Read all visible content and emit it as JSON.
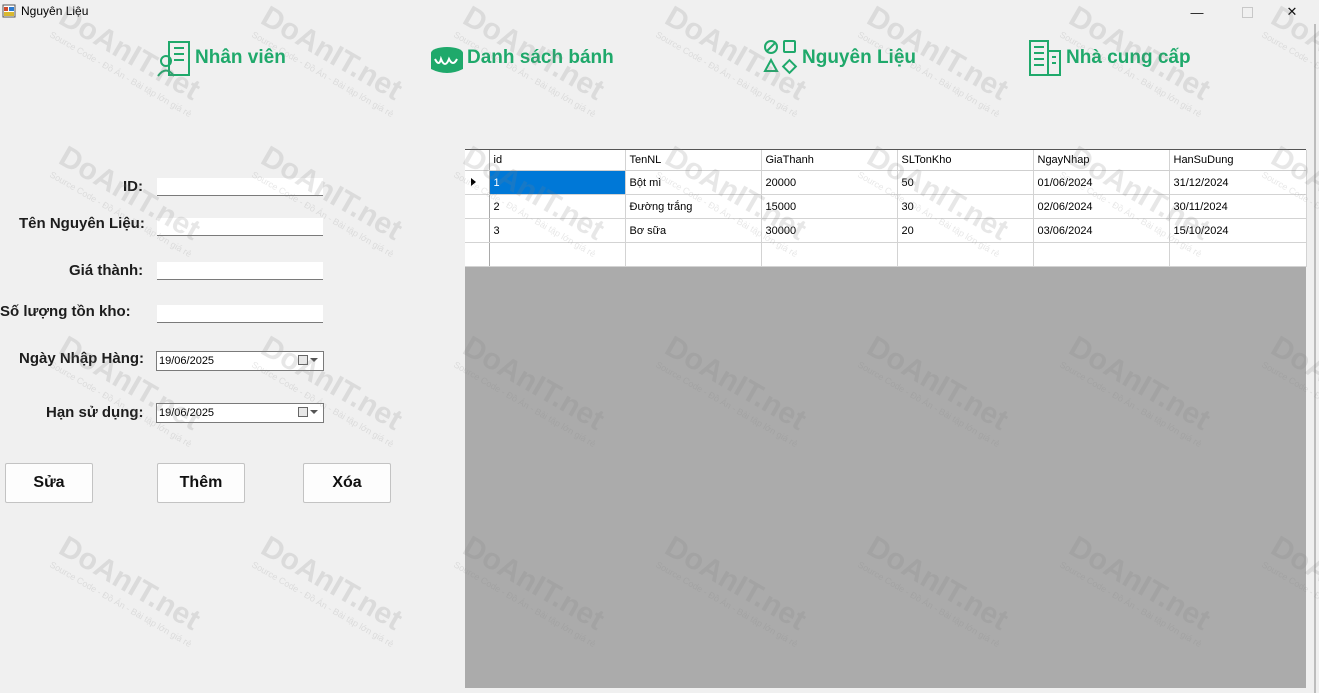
{
  "window": {
    "title": "Nguyên Liệu",
    "minimize_glyph": "—",
    "close_glyph": "✕"
  },
  "nav": [
    {
      "label": "Nhân viên",
      "icon": "employee-building-icon"
    },
    {
      "label": "Danh sách bánh",
      "icon": "cake-icon"
    },
    {
      "label": "Nguyên Liệu",
      "icon": "ingredient-shapes-icon"
    },
    {
      "label": "Nhà cung cấp",
      "icon": "supplier-building-icon"
    }
  ],
  "form": {
    "id_label": "ID:",
    "id_value": "",
    "name_label": "Tên Nguyên Liệu:",
    "name_value": "",
    "price_label": "Giá thành:",
    "price_value": "",
    "stock_label": "Số lượng tồn kho:",
    "stock_value": "",
    "import_date_label": "Ngày Nhập Hàng:",
    "import_date_value": "19/06/2025",
    "expiry_label": "Hạn sử dụng:",
    "expiry_value": "19/06/2025"
  },
  "buttons": {
    "edit": "Sửa",
    "add": "Thêm",
    "delete": "Xóa"
  },
  "grid": {
    "columns": [
      "id",
      "TenNL",
      "GiaThanh",
      "SLTonKho",
      "NgayNhap",
      "HanSuDung"
    ],
    "rows": [
      [
        "1",
        "Bột mì",
        "20000",
        "50",
        "01/06/2024",
        "31/12/2024"
      ],
      [
        "2",
        "Đường trắng",
        "15000",
        "30",
        "02/06/2024",
        "30/11/2024"
      ],
      [
        "3",
        "Bơ sữa",
        "30000",
        "20",
        "03/06/2024",
        "15/10/2024"
      ]
    ],
    "selected_row": 0
  },
  "watermark": {
    "text": "DoAnIT.net",
    "subtext": "Source Code - Đồ Án - Bài tập lớn giá rẻ"
  },
  "colors": {
    "accent": "#1fa96b",
    "selection": "#0078d7",
    "grid_background": "#ababab",
    "window_background": "#f0f0f0"
  }
}
